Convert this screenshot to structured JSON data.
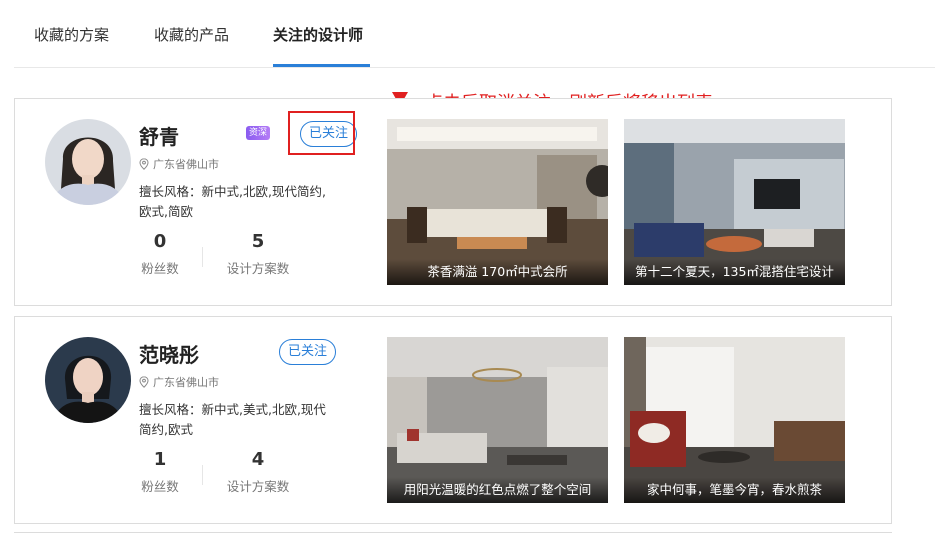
{
  "tabs": [
    {
      "label": "收藏的方案"
    },
    {
      "label": "收藏的产品"
    },
    {
      "label": "关注的设计师",
      "active": true
    }
  ],
  "annotation": "点击后取消关注，刷新后将移出列表。",
  "accent_color": "#2a7fd8",
  "annotation_color": "#e02020",
  "designers": [
    {
      "name": "舒青",
      "tag": "资深",
      "follow_label": "已关注",
      "location": "广东省佛山市",
      "styles": "擅长风格：新中式,北欧,现代简约,欧式,简欧",
      "fans": "0",
      "fans_label": "粉丝数",
      "designs": "5",
      "designs_label": "设计方案数",
      "projects": [
        {
          "caption": "茶香满溢 170㎡中式会所"
        },
        {
          "caption": "第十二个夏天，135㎡混搭住宅设计"
        }
      ]
    },
    {
      "name": "范晓彤",
      "follow_label": "已关注",
      "location": "广东省佛山市",
      "styles": "擅长风格：新中式,美式,北欧,现代简约,欧式",
      "fans": "1",
      "fans_label": "粉丝数",
      "designs": "4",
      "designs_label": "设计方案数",
      "projects": [
        {
          "caption": "用阳光温暖的红色点燃了整个空间"
        },
        {
          "caption": "家中何事，笔墨今宵，春水煎茶"
        }
      ]
    }
  ]
}
